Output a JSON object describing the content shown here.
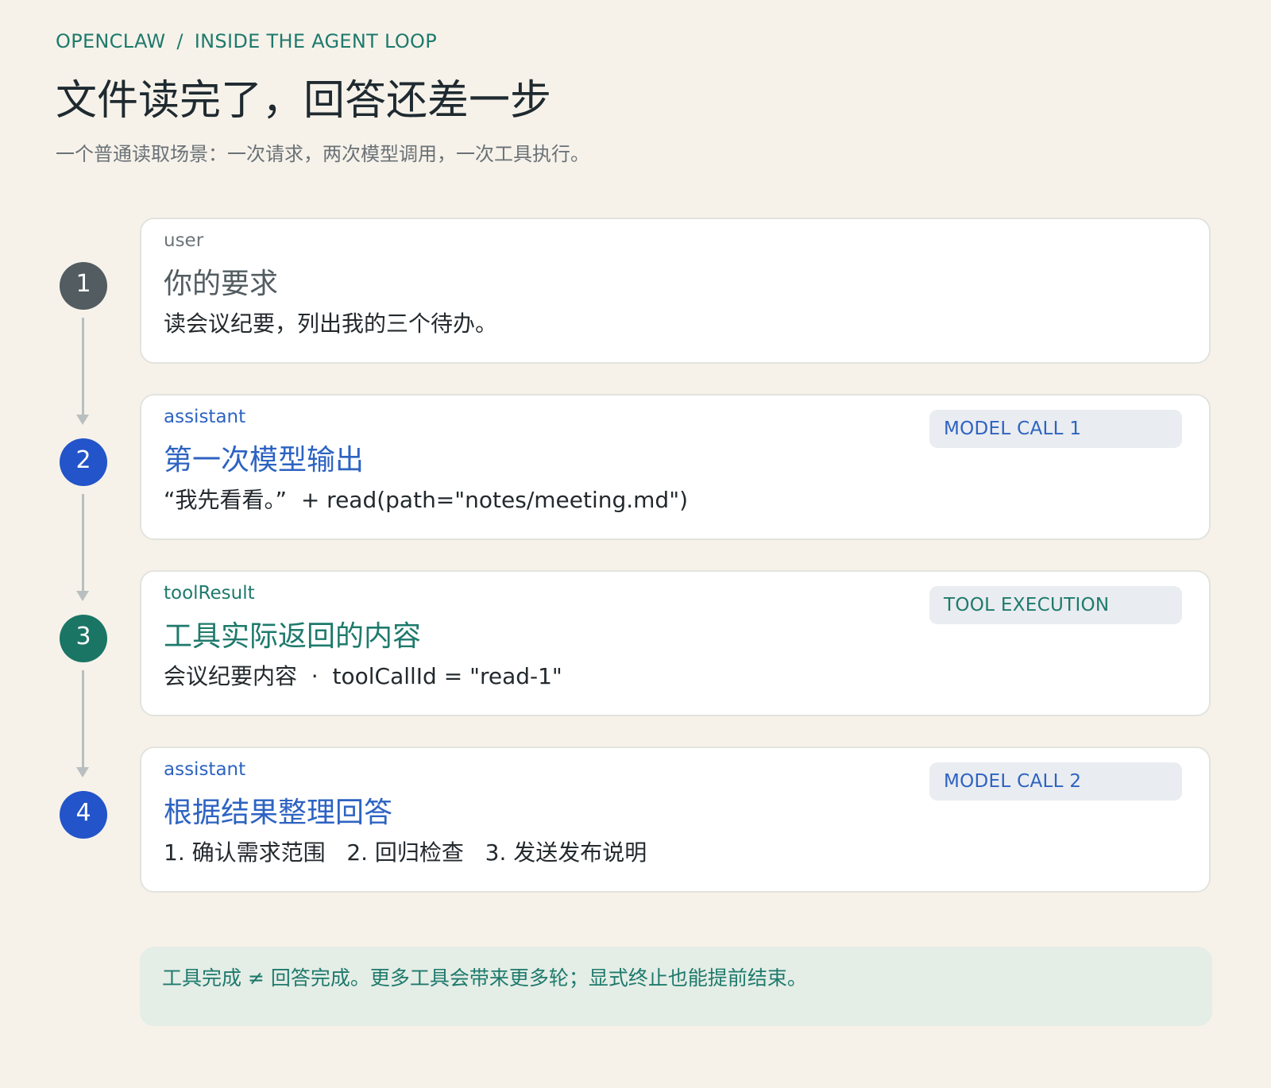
{
  "breadcrumb": {
    "product": "OPENCLAW",
    "separator": "/",
    "section": "INSIDE THE AGENT LOOP"
  },
  "title": "文件读完了，回答还差一步",
  "subtitle": "一个普通读取场景：一次请求，两次模型调用，一次工具执行。",
  "colors": {
    "background": "#f6f2ea",
    "user": "#525c61",
    "assistant": "#2354c9",
    "assistant_text": "#2d63c2",
    "tool": "#1a7565",
    "tool_text": "#1e7a6c",
    "connector": "#b8bfc0"
  },
  "steps": [
    {
      "number": "1",
      "role": "user",
      "heading": "你的要求",
      "body": "读会议纪要，列出我的三个待办。",
      "badge": "",
      "kind": "user"
    },
    {
      "number": "2",
      "role": "assistant",
      "heading": "第一次模型输出",
      "body": "“我先看看。”  + read(path=\"notes/meeting.md\")",
      "badge": "MODEL CALL 1",
      "kind": "assistant"
    },
    {
      "number": "3",
      "role": "toolResult",
      "heading": "工具实际返回的内容",
      "body": "会议纪要内容  ·  toolCallId = \"read-1\"",
      "badge": "TOOL EXECUTION",
      "kind": "tool"
    },
    {
      "number": "4",
      "role": "assistant",
      "heading": "根据结果整理回答",
      "body": "1. 确认需求范围   2. 回归检查   3. 发送发布说明",
      "badge": "MODEL CALL 2",
      "kind": "assistant"
    }
  ],
  "note": "工具完成 ≠ 回答完成。更多工具会带来更多轮；显式终止也能提前结束。"
}
